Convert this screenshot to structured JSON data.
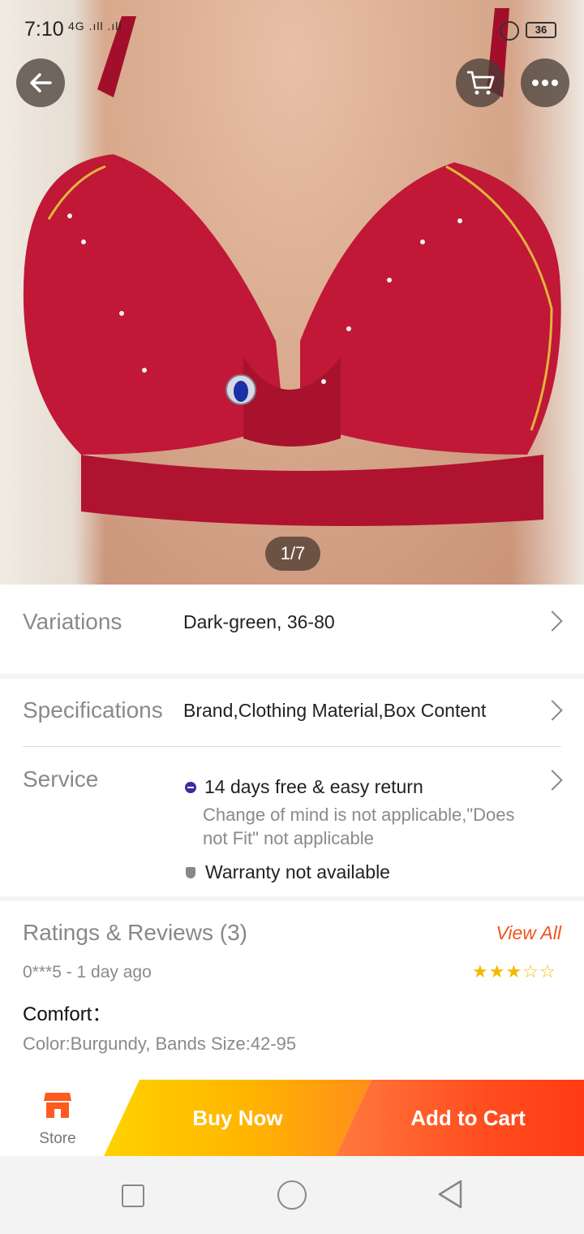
{
  "status_bar": {
    "time": "7:10",
    "signal": "4G .ıll .ıll",
    "battery": "36"
  },
  "top_nav": {
    "back_icon": "arrow-left-icon",
    "cart_icon": "cart-icon",
    "more_icon": "more-dots-icon"
  },
  "gallery": {
    "counter": "1/7"
  },
  "variations": {
    "label": "Variations",
    "value": "Dark-green, 36-80"
  },
  "specifications": {
    "label": "Specifications",
    "value": "Brand,Clothing Material,Box Content"
  },
  "service": {
    "label": "Service",
    "return_title": "14 days free & easy return",
    "return_note": "Change of mind is not applicable,\"Does not Fit\" not applicable",
    "warranty": "Warranty not available"
  },
  "reviews": {
    "title": "Ratings & Reviews (3)",
    "view_all": "View All",
    "reviewer": "0***5 - 1 day ago",
    "rating": 3,
    "rating_max": 5,
    "review_title": "Comfort：",
    "review_meta": "Color:Burgundy, Bands Size:42-95"
  },
  "action_bar": {
    "store_label": "Store",
    "buy_now": "Buy Now",
    "add_to_cart": "Add to Cart"
  },
  "colors": {
    "accent": "#f0541e",
    "buy_now": "#ffc000",
    "add_to_cart": "#ff4d1f",
    "garment": "#b4122e"
  }
}
